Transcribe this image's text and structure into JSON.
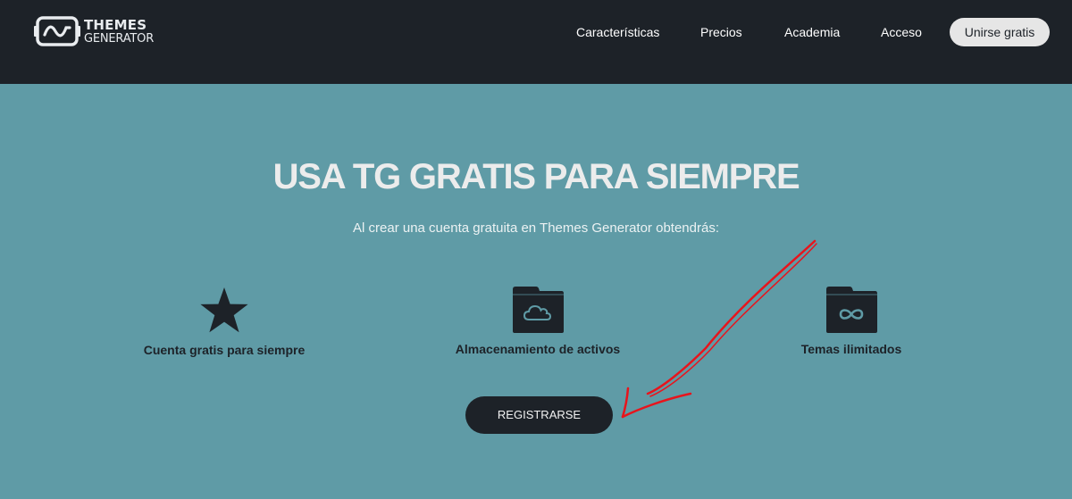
{
  "header": {
    "logo": {
      "line1": "THEMES",
      "line2": "GENERATOR",
      "icon": "logo-icon"
    },
    "nav": [
      {
        "label": "Características"
      },
      {
        "label": "Precios"
      },
      {
        "label": "Academia"
      },
      {
        "label": "Acceso"
      }
    ],
    "join_label": "Unirse gratis"
  },
  "hero": {
    "title_part1": "USA ",
    "title_bold1": "TG",
    "title_part2": " GRATIS PARA ",
    "title_bold2": "SIEMPRE",
    "subtitle": "Al crear una cuenta gratuita en Themes Generator obtendrás:"
  },
  "features": [
    {
      "label": "Cuenta gratis para siempre",
      "icon": "star-icon"
    },
    {
      "label": "Almacenamiento de activos",
      "icon": "cloud-folder-icon"
    },
    {
      "label": "Temas ilimitados",
      "icon": "infinity-folder-icon"
    }
  ],
  "cta": {
    "register_label": "REGISTRARSE"
  },
  "colors": {
    "header_bg": "#1d2228",
    "hero_bg": "#5f9ba6",
    "annotation": "#e8141c"
  }
}
